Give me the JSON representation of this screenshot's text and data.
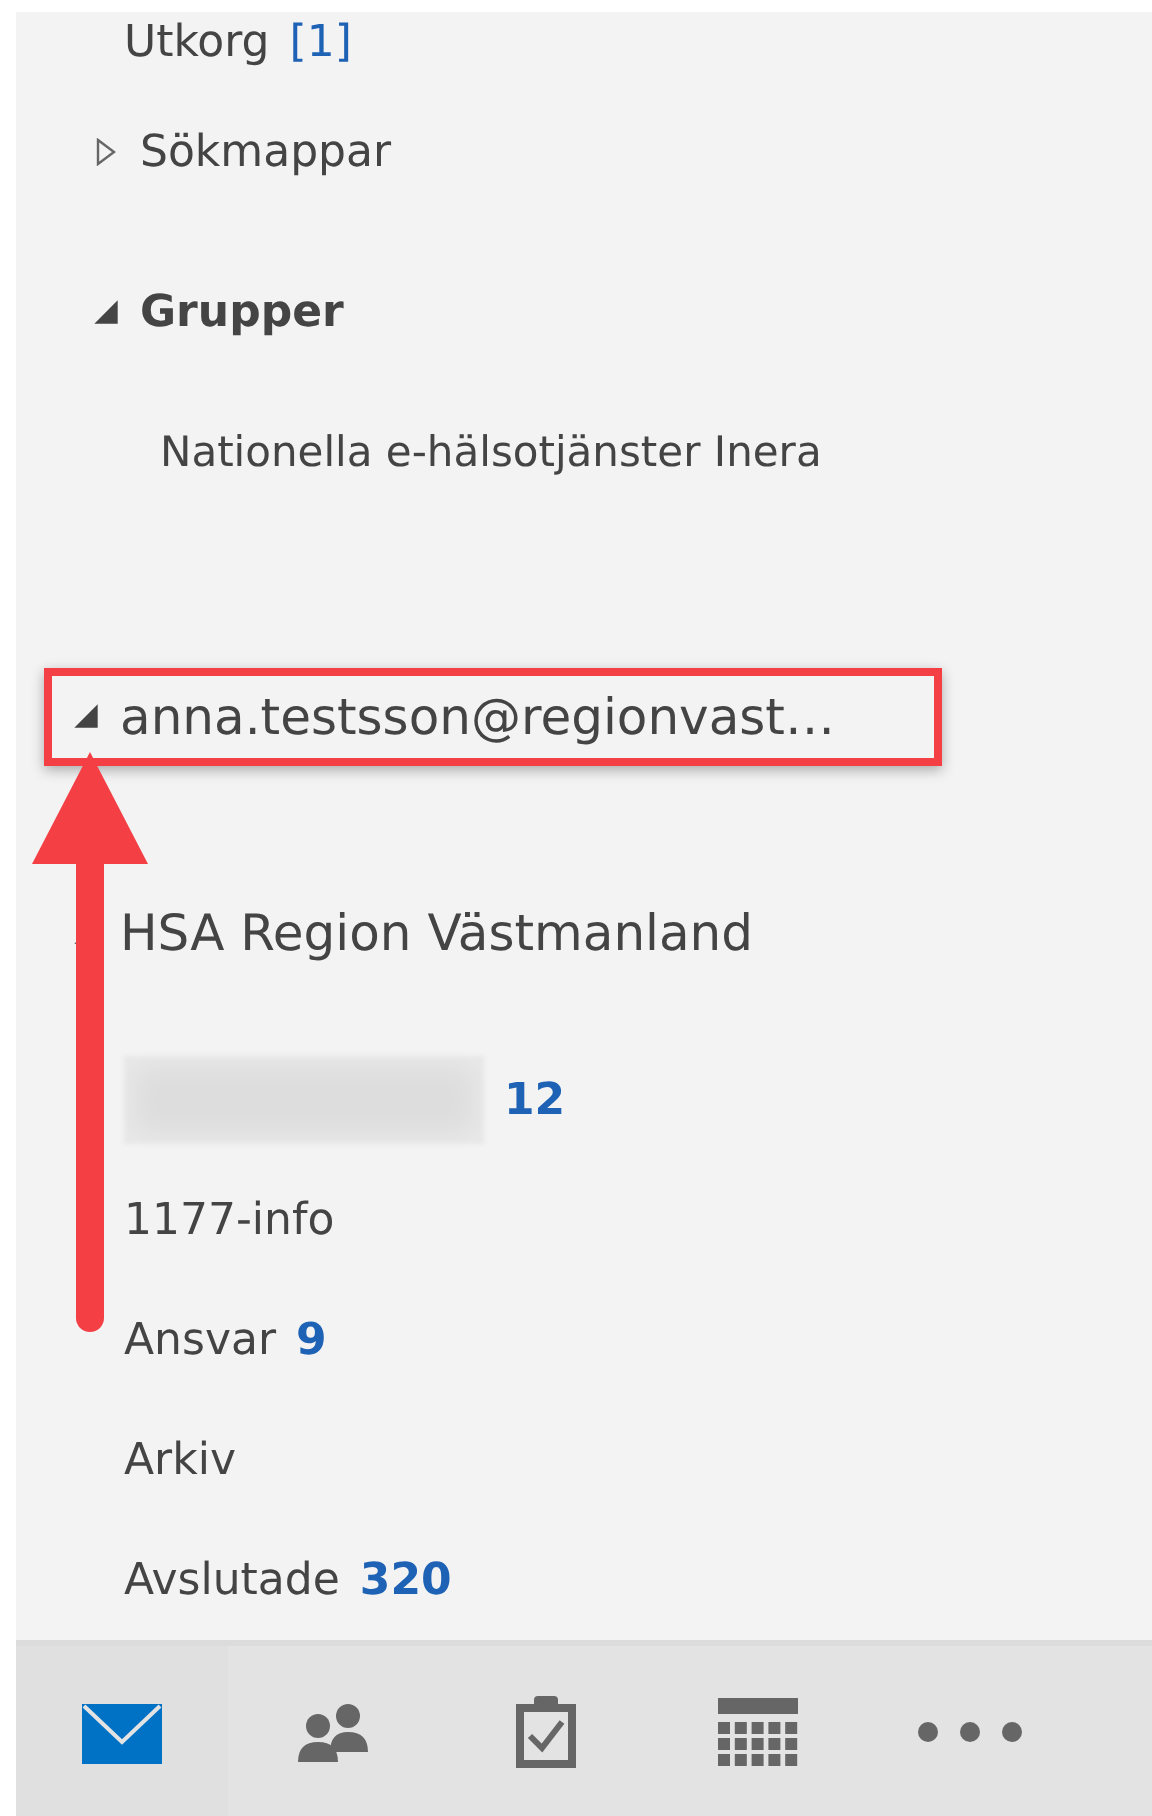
{
  "folders": [
    {
      "kind": "item",
      "label": "Utkorg",
      "count": "[1]",
      "count_bold": false
    },
    {
      "kind": "node",
      "label": "Sökmappar",
      "expanded": false,
      "bold": false
    },
    {
      "kind": "node",
      "label": "Grupper",
      "expanded": true,
      "bold": true,
      "children": [
        {
          "kind": "item",
          "label": "Nationella e-hälsotjänster Inera"
        }
      ]
    },
    {
      "kind": "account",
      "label": "anna.testsson@regionvast…",
      "expanded": true,
      "highlighted": true
    },
    {
      "kind": "account",
      "label": "HSA Region Västmanland",
      "expanded": true,
      "highlighted": false,
      "children": [
        {
          "kind": "redacted",
          "count": "12",
          "count_bold": true
        },
        {
          "kind": "item",
          "label": "1177-info"
        },
        {
          "kind": "item",
          "label": "Ansvar",
          "count": "9",
          "count_bold": true
        },
        {
          "kind": "item",
          "label": "Arkiv"
        },
        {
          "kind": "item",
          "label": "Avslutade",
          "count": "320",
          "count_bold": true
        }
      ]
    }
  ],
  "nav": [
    {
      "kind": "mail",
      "selected": true
    },
    {
      "kind": "people",
      "selected": false
    },
    {
      "kind": "tasks",
      "selected": false
    },
    {
      "kind": "calendar",
      "selected": false
    },
    {
      "kind": "more",
      "selected": false
    }
  ]
}
